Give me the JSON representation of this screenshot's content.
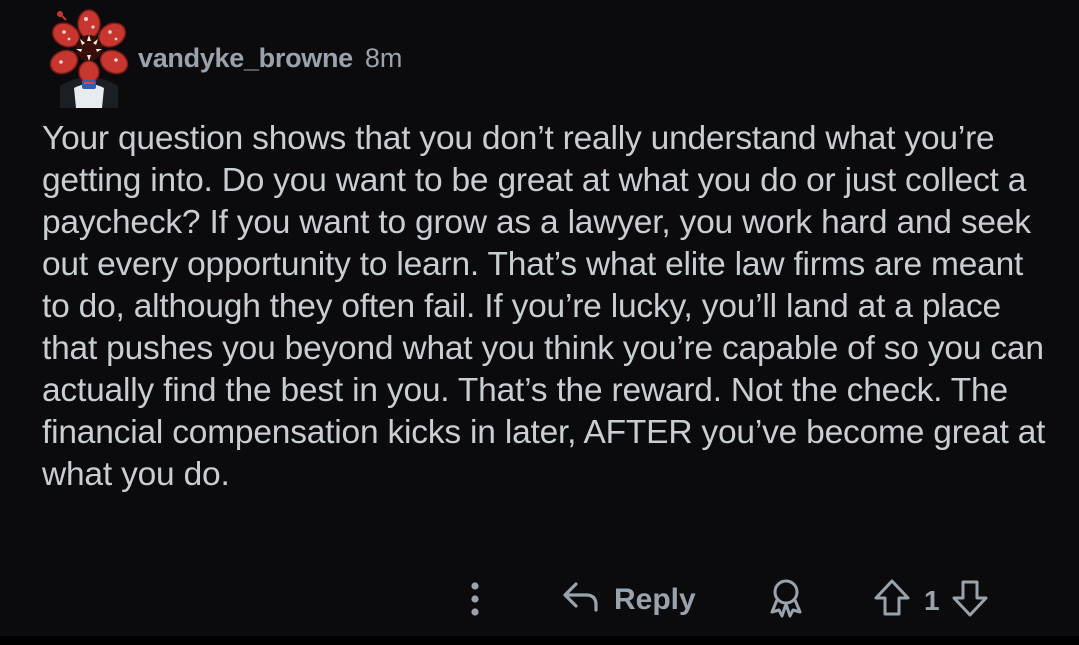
{
  "comment": {
    "username": "vandyke_browne",
    "age": "8m",
    "text": "Your question shows that you don’t really understand what you’re getting into. Do you want to be great at what you do or just collect a paycheck? If you want to grow as a lawyer, you work hard and seek out every opportunity to learn. That’s what elite law firms are meant to do, although they often fail. If you’re lucky, you’ll land at a place that pushes you beyond what you think you’re capable of so you can actually find the best in you. That’s the reward. Not the check. The financial compensation kicks in later, AFTER you’ve become great at what you do.",
    "avatar_icon": "demogorgon-avatar-icon"
  },
  "actions": {
    "more_icon": "more-vertical-icon",
    "reply_icon": "reply-arrow-icon",
    "reply_label": "Reply",
    "award_icon": "award-icon",
    "upvote_icon": "upvote-arrow-icon",
    "vote_count": "1",
    "downvote_icon": "downvote-arrow-icon"
  },
  "colors": {
    "background": "#0b0b0d",
    "text": "#c9ced3",
    "meta": "#9aa3ab",
    "avatar_accent": "#c7362f"
  }
}
